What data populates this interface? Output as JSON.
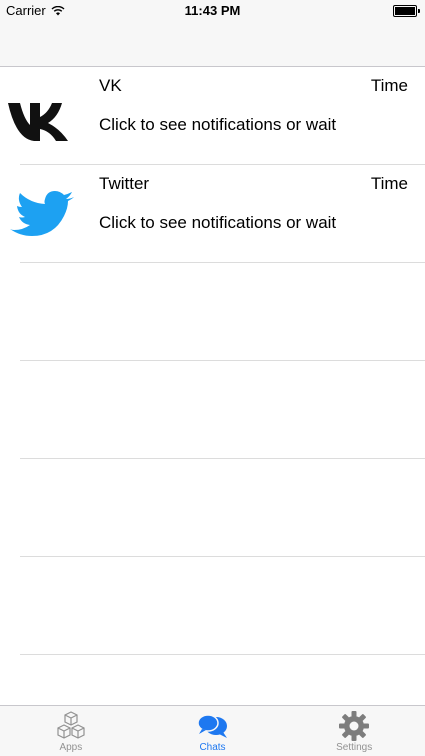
{
  "status_bar": {
    "carrier": "Carrier",
    "time": "11:43 PM"
  },
  "chats": [
    {
      "title": "VK",
      "time": "Time",
      "subtitle": "Click to see notifications or wait",
      "icon": "vk-logo-icon"
    },
    {
      "title": "Twitter",
      "time": "Time",
      "subtitle": "Click to see notifications or wait",
      "icon": "twitter-bird-icon"
    }
  ],
  "tabs": [
    {
      "label": "Apps",
      "icon": "cubes-icon",
      "active": false
    },
    {
      "label": "Chats",
      "icon": "chat-bubbles-icon",
      "active": true
    },
    {
      "label": "Settings",
      "icon": "gear-icon",
      "active": false
    }
  ],
  "colors": {
    "accent": "#1e78f0",
    "twitter": "#1da1f2",
    "tab_inactive": "#929292"
  }
}
